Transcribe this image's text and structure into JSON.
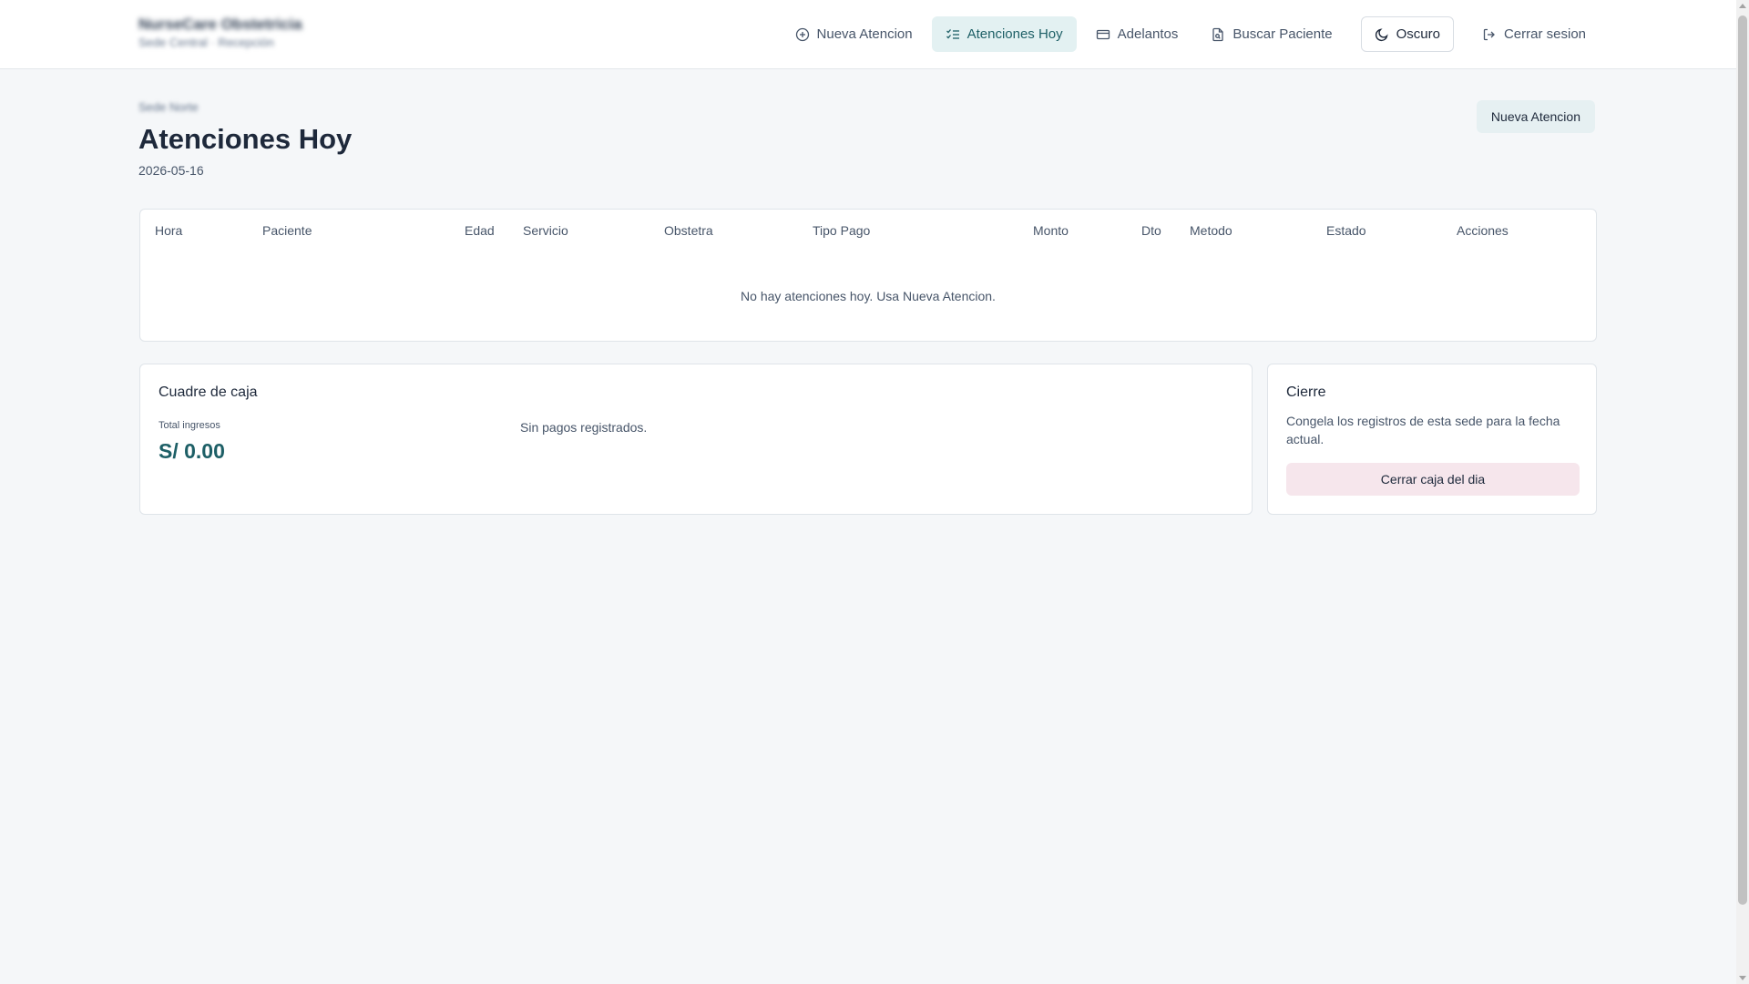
{
  "header": {
    "brand_name": "NurseCare Obstetricia",
    "brand_subtitle": "Sede Central · Recepción"
  },
  "nav": {
    "items": [
      {
        "label": "Nueva Atencion",
        "icon": "plus-circle-icon"
      },
      {
        "label": "Atenciones Hoy",
        "icon": "list-check-icon",
        "active": true
      },
      {
        "label": "Adelantos",
        "icon": "credit-card-icon"
      },
      {
        "label": "Buscar Paciente",
        "icon": "file-search-icon"
      },
      {
        "label": "Oscuro",
        "icon": "moon-icon"
      },
      {
        "label": "Cerrar sesion",
        "icon": "logout-icon"
      }
    ]
  },
  "page": {
    "breadcrumb": "Sede Norte",
    "title": "Atenciones Hoy",
    "date": "2026-05-16",
    "new_button": "Nueva Atencion"
  },
  "table": {
    "columns": [
      "Hora",
      "Paciente",
      "Edad",
      "Servicio",
      "Obstetra",
      "Tipo Pago",
      "Monto",
      "Dto",
      "Metodo",
      "Estado",
      "Acciones"
    ],
    "empty_message": "No hay atenciones hoy. Usa Nueva Atencion."
  },
  "caja": {
    "title": "Cuadre de caja",
    "total_label": "Total ingresos",
    "total_value": "S/ 0.00",
    "empty_message": "Sin pagos registrados."
  },
  "cierre": {
    "title": "Cierre",
    "description": "Congela los registros de esta sede para la fecha actual.",
    "button": "Cerrar caja del dia"
  },
  "colors": {
    "accent": "#1d5f66",
    "active_nav_bg": "#e3f1f2",
    "danger_button_bg": "#f6e6ec",
    "page_bg": "#f5f7f9"
  }
}
